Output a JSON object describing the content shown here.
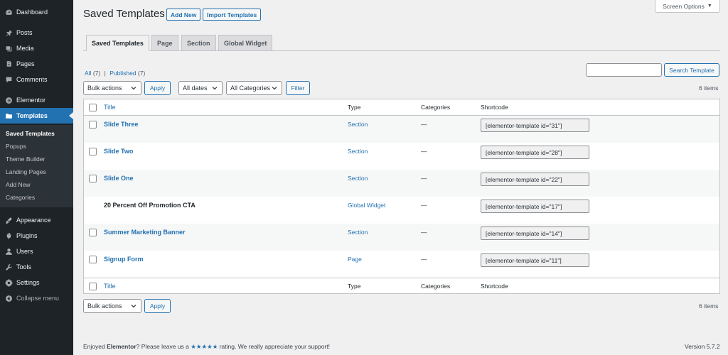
{
  "sidebar": {
    "items": [
      {
        "label": "Dashboard",
        "icon": "dashboard-icon"
      },
      {
        "label": "Posts",
        "icon": "pin-icon"
      },
      {
        "label": "Media",
        "icon": "media-icon"
      },
      {
        "label": "Pages",
        "icon": "pages-icon"
      },
      {
        "label": "Comments",
        "icon": "comment-icon"
      },
      {
        "label": "Elementor",
        "icon": "elementor-icon"
      },
      {
        "label": "Templates",
        "icon": "folder-icon"
      },
      {
        "label": "Appearance",
        "icon": "brush-icon"
      },
      {
        "label": "Plugins",
        "icon": "plug-icon"
      },
      {
        "label": "Users",
        "icon": "user-icon"
      },
      {
        "label": "Tools",
        "icon": "wrench-icon"
      },
      {
        "label": "Settings",
        "icon": "settings-icon"
      },
      {
        "label": "Collapse menu",
        "icon": "collapse-icon"
      }
    ],
    "submenu": [
      "Saved Templates",
      "Popups",
      "Theme Builder",
      "Landing Pages",
      "Add New",
      "Categories"
    ]
  },
  "header": {
    "title": "Saved Templates",
    "add_new": "Add New",
    "import": "Import Templates",
    "screen_options": "Screen Options"
  },
  "tabs": [
    "Saved Templates",
    "Page",
    "Section",
    "Global Widget"
  ],
  "filters": {
    "all": "All",
    "all_count": "(7)",
    "separator": "|",
    "published": "Published",
    "published_count": "(7)",
    "search_value": "",
    "search_button": "Search Template",
    "bulk_actions": "Bulk actions",
    "apply": "Apply",
    "dates": "All dates",
    "categories": "All Categories",
    "filter": "Filter",
    "items_count": "6 items"
  },
  "table": {
    "columns": [
      "Title",
      "Type",
      "Categories",
      "Shortcode"
    ],
    "rows": [
      {
        "title": "Slide Three",
        "type": "Section",
        "categories": "—",
        "shortcode": "[elementor-template id=\"31\"]"
      },
      {
        "title": "Slide Two",
        "type": "Section",
        "categories": "—",
        "shortcode": "[elementor-template id=\"28\"]"
      },
      {
        "title": "Slide One",
        "type": "Section",
        "categories": "—",
        "shortcode": "[elementor-template id=\"22\"]"
      },
      {
        "title": "20 Percent Off Promotion CTA",
        "type": "Global Widget",
        "categories": "—",
        "shortcode": "[elementor-template id=\"17\"]"
      },
      {
        "title": "Summer Marketing Banner",
        "type": "Section",
        "categories": "—",
        "shortcode": "[elementor-template id=\"14\"]"
      },
      {
        "title": "Signup Form",
        "type": "Page",
        "categories": "—",
        "shortcode": "[elementor-template id=\"11\"]"
      }
    ]
  },
  "footer": {
    "left_pre": "Enjoyed ",
    "left_brand": "Elementor",
    "left_mid": "? Please leave us a ",
    "stars": "★★★★★",
    "left_post": " rating. We really appreciate your support!",
    "version": "Version 5.7.2"
  },
  "colors": {
    "accent": "#2271b1",
    "sidebar": "#1d2327"
  }
}
